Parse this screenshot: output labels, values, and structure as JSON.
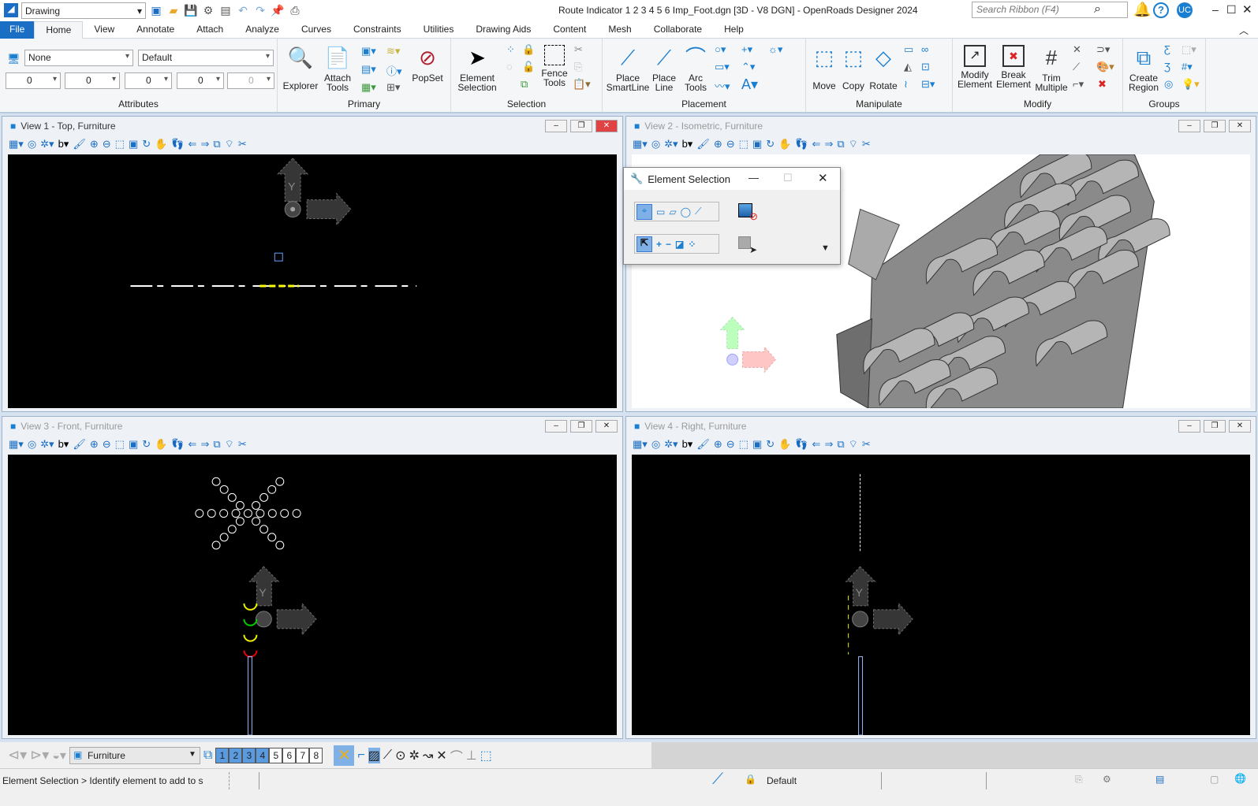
{
  "titlebar": {
    "workflow": "Drawing",
    "title": "Route Indicator 1 2 3 4 5 6 Imp_Foot.dgn [3D - V8 DGN] - OpenRoads Designer 2024",
    "search_placeholder": "Search Ribbon (F4)",
    "user": "UC"
  },
  "tabs": [
    "File",
    "Home",
    "View",
    "Annotate",
    "Attach",
    "Analyze",
    "Curves",
    "Constraints",
    "Utilities",
    "Drawing Aids",
    "Content",
    "Mesh",
    "Collaborate",
    "Help"
  ],
  "ribbon": {
    "attributes": {
      "label": "Attributes",
      "level": "None",
      "template": "Default",
      "color": "0",
      "style": "0",
      "weight": "0",
      "transparency": "0",
      "priority": "0"
    },
    "primary": {
      "label": "Primary",
      "explorer": "Explorer",
      "attach_tools": "Attach Tools",
      "popset": "PopSet"
    },
    "selection": {
      "label": "Selection",
      "element_selection": "Element Selection",
      "fence_tools": "Fence Tools"
    },
    "placement": {
      "label": "Placement",
      "smartline": "Place SmartLine",
      "line": "Place Line",
      "arc": "Arc Tools"
    },
    "manipulate": {
      "label": "Manipulate",
      "move": "Move",
      "copy": "Copy",
      "rotate": "Rotate"
    },
    "modify": {
      "label": "Modify",
      "modify_element": "Modify Element",
      "break_element": "Break Element",
      "trim": "Trim Multiple"
    },
    "groups": {
      "label": "Groups",
      "create_region": "Create Region"
    }
  },
  "views": [
    {
      "title": "View 1 - Top, Furniture",
      "background": "#000000"
    },
    {
      "title": "View 2 - Isometric, Furniture",
      "background": "#ffffff"
    },
    {
      "title": "View 3 - Front, Furniture",
      "background": "#000000"
    },
    {
      "title": "View 4 - Right, Furniture",
      "background": "#000000"
    }
  ],
  "dialog": {
    "title": "Element Selection"
  },
  "bottom_toolbar": {
    "model": "Furniture",
    "view_numbers": [
      "1",
      "2",
      "3",
      "4",
      "5",
      "6",
      "7",
      "8"
    ],
    "active_views": [
      1,
      2,
      3,
      4
    ]
  },
  "status": {
    "prompt": "Element Selection > Identify element to add to s",
    "active_level": "Default"
  }
}
